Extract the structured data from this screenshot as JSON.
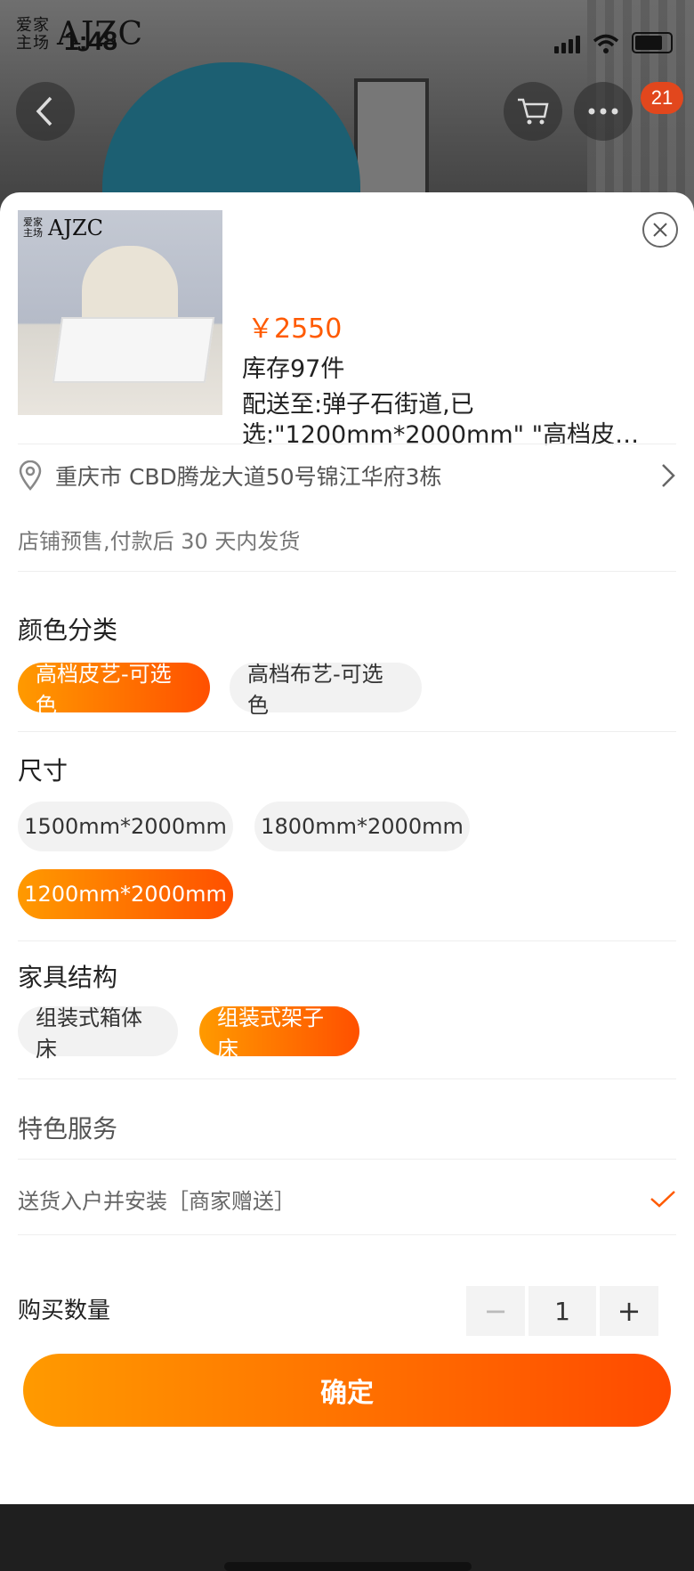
{
  "header": {
    "brand_cn": "爱家主场",
    "brand_en": "AJZC",
    "status_time": "1:48",
    "cart_badge": "21"
  },
  "sku": {
    "price": "￥2550",
    "stock": "库存97件",
    "delivery_line1": "配送至:弹子石街道,已",
    "delivery_line2": "选:\"1200mm*2000mm\" \"高档皮…",
    "address": "重庆市 CBD腾龙大道50号锦江华府3栋",
    "pre_sale": "店铺预售,付款后 30 天内发货"
  },
  "color": {
    "title": "颜色分类",
    "options": [
      "高档皮艺-可选色",
      "高档布艺-可选色"
    ],
    "selected": "高档皮艺-可选色"
  },
  "size": {
    "title": "尺寸",
    "options": [
      "1500mm*2000mm",
      "1800mm*2000mm",
      "1200mm*2000mm"
    ],
    "selected": "1200mm*2000mm"
  },
  "structure": {
    "title": "家具结构",
    "options": [
      "组装式箱体床",
      "组装式架子床"
    ],
    "selected": "组装式架子床"
  },
  "service": {
    "title": "特色服务",
    "item": "送货入户并安装［商家赠送］",
    "checked": true
  },
  "quantity": {
    "label": "购买数量",
    "value": "1",
    "minus": "−",
    "plus": "+"
  },
  "confirm_label": "确定",
  "colors": {
    "accent": "#ff5a00"
  }
}
